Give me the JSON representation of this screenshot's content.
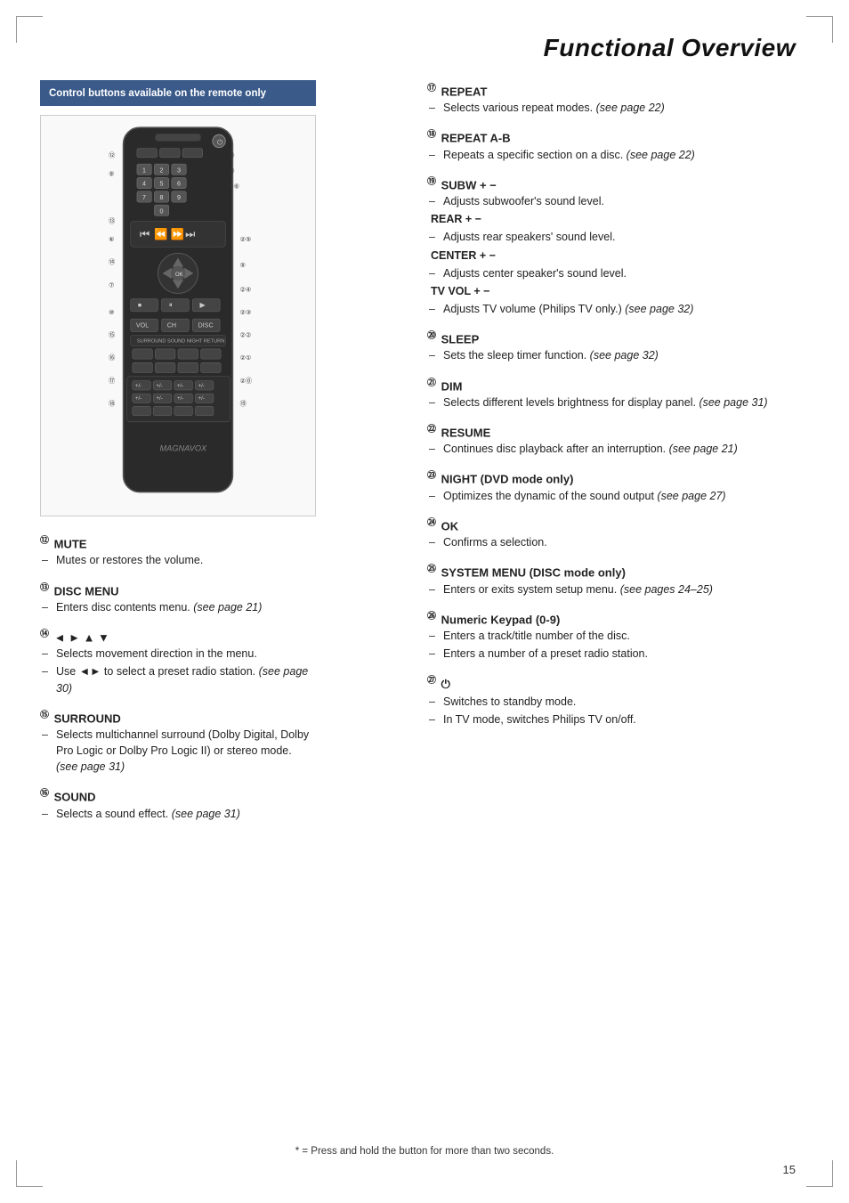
{
  "page": {
    "title": "Functional Overview",
    "number": "15",
    "footer_note": "* = Press and hold the button for more than two seconds."
  },
  "control_box": {
    "label": "Control buttons available on the remote only"
  },
  "sections_left": [
    {
      "id": "12",
      "title": "MUTE",
      "bullets": [
        {
          "text": "Mutes or restores the volume."
        }
      ]
    },
    {
      "id": "13",
      "title": "DISC MENU",
      "bullets": [
        {
          "text": "Enters disc contents menu. (see page 21)"
        }
      ]
    },
    {
      "id": "14",
      "title": "◄ ► ▲ ▼",
      "bullets": [
        {
          "text": "Selects movement direction in the menu."
        },
        {
          "text": "Use ◄► to select a preset radio station. (see page 30)"
        }
      ]
    },
    {
      "id": "15",
      "title": "SURROUND",
      "bullets": [
        {
          "text": "Selects multichannel surround (Dolby Digital, Dolby Pro Logic or Dolby Pro Logic II) or stereo mode. (see page 31)"
        }
      ]
    },
    {
      "id": "16",
      "title": "SOUND",
      "bullets": [
        {
          "text": "Selects a sound effect. (see page 31)"
        }
      ]
    }
  ],
  "sections_right": [
    {
      "id": "17",
      "title": "REPEAT",
      "bullets": [
        {
          "text": "Selects various repeat modes. (see page 22)"
        }
      ]
    },
    {
      "id": "18",
      "title": "REPEAT A-B",
      "bullets": [
        {
          "text": "Repeats a specific section on a disc. (see page 22)"
        }
      ]
    },
    {
      "id": "19",
      "title": "SUBW + −",
      "sub_sections": [
        {
          "label": "SUBW + −",
          "desc": "Adjusts subwoofer's sound level."
        },
        {
          "label": "REAR + −",
          "desc": "Adjusts rear speakers' sound level."
        },
        {
          "label": "CENTER + −",
          "desc": "Adjusts center speaker's sound level."
        },
        {
          "label": "TV VOL + −",
          "desc": "Adjusts TV volume (Philips TV only.) (see page 32)"
        }
      ]
    },
    {
      "id": "20",
      "title": "SLEEP",
      "bullets": [
        {
          "text": "Sets the sleep timer function. (see page 32)"
        }
      ]
    },
    {
      "id": "21",
      "title": "DIM",
      "bullets": [
        {
          "text": "Selects different levels brightness for display panel. (see page 31)"
        }
      ]
    },
    {
      "id": "22",
      "title": "RESUME",
      "bullets": [
        {
          "text": "Continues disc playback after an interruption. (see page 21)"
        }
      ]
    },
    {
      "id": "23",
      "title": "NIGHT (DVD mode only)",
      "bullets": [
        {
          "text": "Optimizes the dynamic of the sound output (see page 27)"
        }
      ]
    },
    {
      "id": "24",
      "title": "OK",
      "bullets": [
        {
          "text": "Confirms a selection."
        }
      ]
    },
    {
      "id": "25",
      "title": "SYSTEM MENU (DISC mode only)",
      "bullets": [
        {
          "text": "Enters or exits system setup menu. (see pages 24–25)"
        }
      ]
    },
    {
      "id": "26",
      "title": "Numeric Keypad (0-9)",
      "bullets": [
        {
          "text": "Enters a track/title number of the disc."
        },
        {
          "text": "Enters a number of a preset radio station."
        }
      ]
    },
    {
      "id": "27",
      "title": "⏻",
      "bullets": [
        {
          "text": "Switches to standby mode."
        },
        {
          "text": "In TV mode, switches Philips TV on/off."
        }
      ]
    }
  ]
}
